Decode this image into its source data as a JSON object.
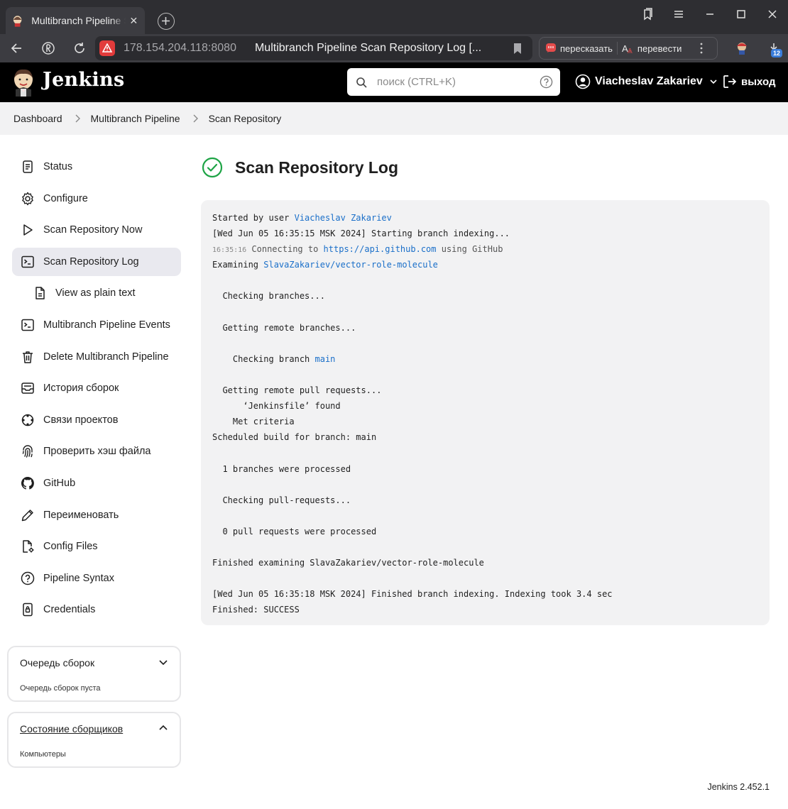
{
  "browser": {
    "tab_title": "Multibranch Pipeline Scan Repository Log [Jenkins]",
    "address_host": "178.154.204.118:8080",
    "address_title": "Multibranch Pipeline Scan Repository Log [...",
    "retell_label": "пересказать",
    "translate_label": "перевести",
    "downloads_count": "12"
  },
  "header": {
    "brand": "Jenkins",
    "search_placeholder": "поиск (CTRL+K)",
    "user_name": "Viacheslav Zakariev",
    "logout_label": "выход"
  },
  "breadcrumb": {
    "items": [
      "Dashboard",
      "Multibranch Pipeline",
      "Scan Repository"
    ]
  },
  "sidebar": {
    "items": [
      {
        "label": "Status",
        "icon": "document-icon"
      },
      {
        "label": "Configure",
        "icon": "gear-icon"
      },
      {
        "label": "Scan Repository Now",
        "icon": "play-icon"
      },
      {
        "label": "Scan Repository Log",
        "icon": "terminal-icon",
        "active": true
      },
      {
        "label": "View as plain text",
        "icon": "file-text-icon",
        "sub": true
      },
      {
        "label": "Multibranch Pipeline Events",
        "icon": "terminal-icon"
      },
      {
        "label": "Delete Multibranch Pipeline",
        "icon": "trash-icon"
      },
      {
        "label": "История сборок",
        "icon": "inbox-icon"
      },
      {
        "label": "Связи проектов",
        "icon": "relationship-icon"
      },
      {
        "label": "Проверить хэш файла",
        "icon": "fingerprint-icon"
      },
      {
        "label": "GitHub",
        "icon": "github-icon"
      },
      {
        "label": "Переименовать",
        "icon": "pencil-icon"
      },
      {
        "label": "Config Files",
        "icon": "config-file-icon"
      },
      {
        "label": "Pipeline Syntax",
        "icon": "help-icon"
      },
      {
        "label": "Credentials",
        "icon": "credentials-icon"
      }
    ],
    "queue": {
      "title": "Очередь сборок",
      "body": "Очередь сборок пуста"
    },
    "executors": {
      "title": "Состояние сборщиков",
      "body": "Компьютеры"
    }
  },
  "main": {
    "title": "Scan Repository Log",
    "status_color": "#1ea446"
  },
  "log": {
    "l1_prefix": "Started by user ",
    "l1_user": "Viacheslav Zakariev",
    "l2": "[Wed Jun 05 16:35:15 MSK 2024] Starting branch indexing...",
    "l3_ts": "16:35:16",
    "l3_text": " Connecting to ",
    "l3_link": "https://api.github.com",
    "l3_suffix": " using GitHub",
    "l4_prefix": "Examining ",
    "l4_repo": "SlavaZakariev/vector-role-molecule",
    "l6": "  Checking branches...",
    "l8": "  Getting remote branches...",
    "l10_prefix": "    Checking branch ",
    "l10_branch": "main",
    "l12": "  Getting remote pull requests...",
    "l13": "      ‘Jenkinsfile’ found",
    "l14": "    Met criteria",
    "l15": "Scheduled build for branch: main",
    "l17": "  1 branches were processed",
    "l19": "  Checking pull-requests...",
    "l21": "  0 pull requests were processed",
    "l23": "Finished examining SlavaZakariev/vector-role-molecule",
    "l25": "[Wed Jun 05 16:35:18 MSK 2024] Finished branch indexing. Indexing took 3.4 sec",
    "l26": "Finished: SUCCESS"
  },
  "footer": {
    "version": "Jenkins 2.452.1"
  }
}
